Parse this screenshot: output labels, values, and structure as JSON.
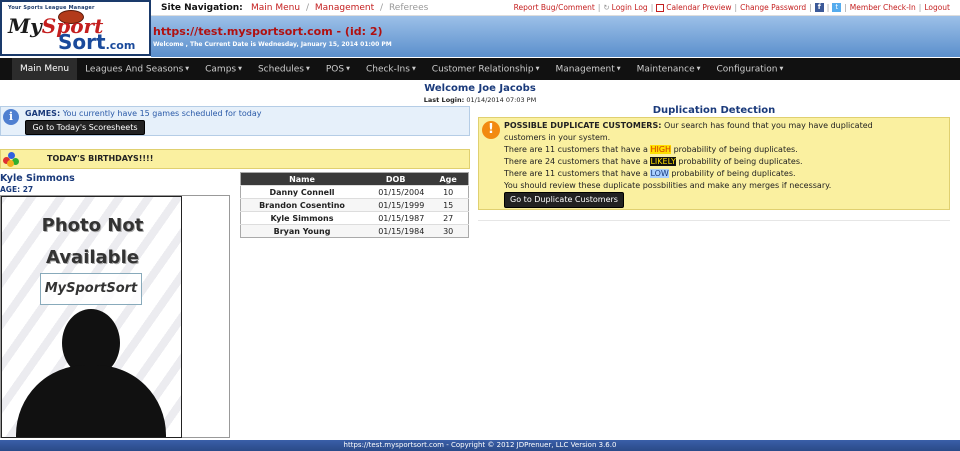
{
  "logo": {
    "tagline": "Your Sports League Manager",
    "word1a": "My",
    "word1b": "Sport",
    "word2": "Sort",
    "word2b": ".com"
  },
  "site_nav": {
    "label": "Site Navigation:",
    "crumbs": [
      "Main Menu",
      "Management",
      "Referees"
    ]
  },
  "top_links": [
    "Report Bug/Comment",
    "Login Log",
    "Calendar Preview",
    "Change Password",
    "Member Check-In",
    "Logout"
  ],
  "header": {
    "site_url": "https://test.mysportsort.com - (id: 2)",
    "welcome_date": "Welcome , The Current Date is Wednesday, January 15, 2014 01:00 PM"
  },
  "main_nav": [
    {
      "label": "Main Menu",
      "caret": false
    },
    {
      "label": "Leagues And Seasons",
      "caret": true
    },
    {
      "label": "Camps",
      "caret": true
    },
    {
      "label": "Schedules",
      "caret": true
    },
    {
      "label": "POS",
      "caret": true
    },
    {
      "label": "Check-Ins",
      "caret": true
    },
    {
      "label": "Customer Relationship",
      "caret": true
    },
    {
      "label": "Management",
      "caret": true
    },
    {
      "label": "Maintenance",
      "caret": true
    },
    {
      "label": "Configuration",
      "caret": true
    }
  ],
  "welcome": {
    "name": "Welcome Joe Jacobs",
    "last_login_label": "Last Login:",
    "last_login_value": "01/14/2014 07:03 PM"
  },
  "games": {
    "label": "GAMES:",
    "text": "You currently have 15 games scheduled for today",
    "button": "Go to Today's Scoresheets"
  },
  "birthdays": {
    "title": "TODAY'S BIRTHDAYS!!!!",
    "person_name": "Kyle Simmons",
    "person_age": "AGE: 27",
    "photo_text1": "Photo Not",
    "photo_text2": "Available",
    "photo_logo": "MySportSort",
    "columns": [
      "Name",
      "DOB",
      "Age"
    ],
    "rows": [
      {
        "name": "Danny Connell",
        "dob": "01/15/2004",
        "age": "10"
      },
      {
        "name": "Brandon Cosentino",
        "dob": "01/15/1999",
        "age": "15"
      },
      {
        "name": "Kyle Simmons",
        "dob": "01/15/1987",
        "age": "27"
      },
      {
        "name": "Bryan Young",
        "dob": "01/15/1984",
        "age": "30"
      }
    ]
  },
  "duplication": {
    "title": "Duplication Detection",
    "heading": "POSSIBLE DUPLICATE CUSTOMERS:",
    "intro": " Our search has found that you may have duplicated",
    "intro2": "customers in your system.",
    "high_pre": "There are 11 customers that have a ",
    "high_word": "HIGH",
    "high_post": " probability of being duplicates.",
    "likely_pre": "There are 24 customers that have a ",
    "likely_word": "LIKELY",
    "likely_post": " probability of being duplicates.",
    "low_pre": "There are 11 customers that have a ",
    "low_word": "LOW",
    "low_post": " probability of being duplicates.",
    "review": "You should review these duplicate possbilities and make any merges if necessary.",
    "button": "Go to Duplicate Customers"
  },
  "footer": {
    "text": "https://test.mysportsort.com - Copyright © 2012 JDPrenuer, LLC Version 3.6.0"
  },
  "colors": {
    "accent_red": "#c41e1e",
    "nav_black": "#111111",
    "header_blue": "#5b8fcc",
    "highlight_yellow": "#faf0a0",
    "title_blue": "#1a3a7b"
  }
}
